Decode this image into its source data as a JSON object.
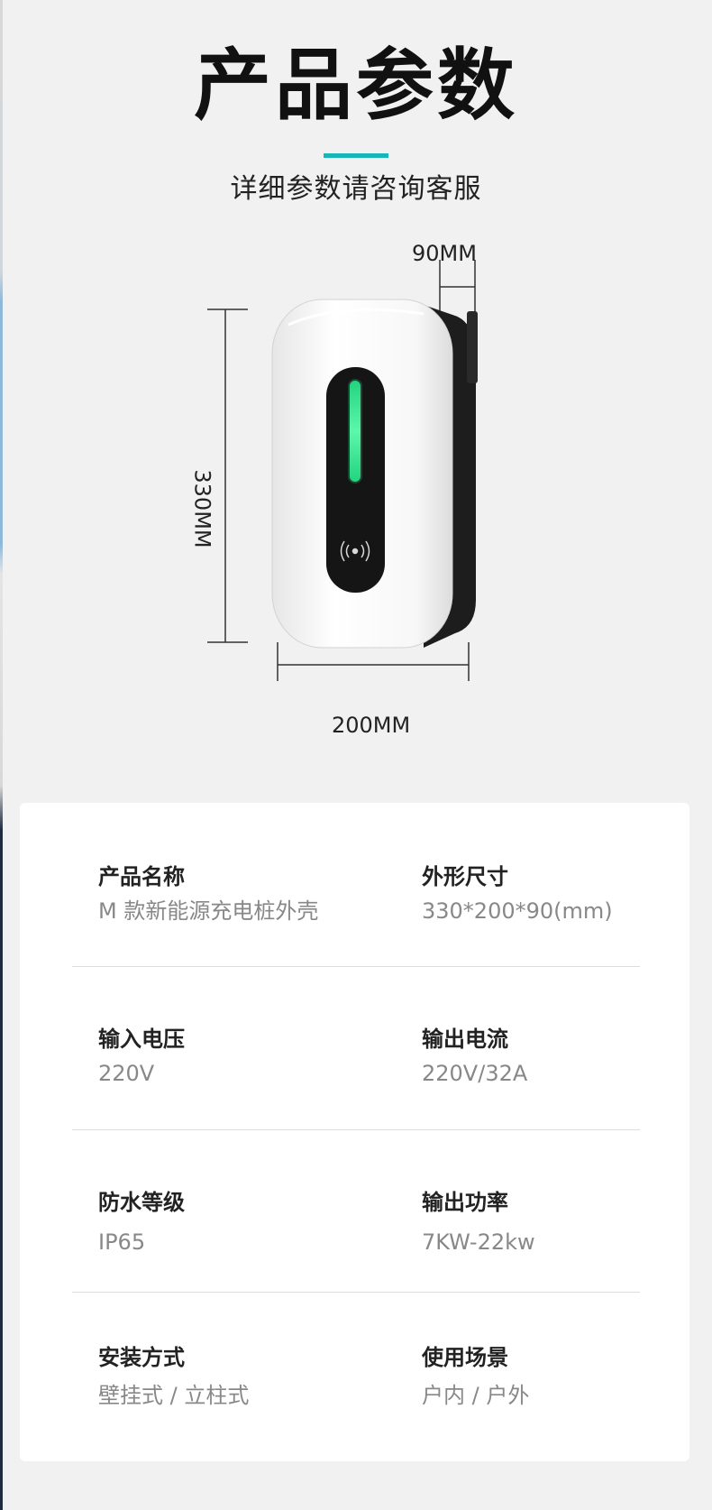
{
  "header": {
    "title": "产品参数",
    "subtitle": "详细参数请咨询客服",
    "accent_color": "#19b6b7"
  },
  "diagram": {
    "depth_label": "90MM",
    "height_label": "330MM",
    "width_label": "200MM",
    "indicator_color": "#2ee08a",
    "icons": [
      "charger-body-icon",
      "nfc-card-reader-icon"
    ]
  },
  "specs": {
    "rows": [
      {
        "left": {
          "label": "产品名称",
          "value": "M 款新能源充电桩外壳"
        },
        "right": {
          "label": "外形尺寸",
          "value": "330*200*90(mm)"
        }
      },
      {
        "left": {
          "label": "输入电压",
          "value": "220V"
        },
        "right": {
          "label": "输出电流",
          "value": "220V/32A"
        }
      },
      {
        "left": {
          "label": "防水等级",
          "value": "IP65"
        },
        "right": {
          "label": "输出功率",
          "value": "7KW-22kw"
        }
      },
      {
        "left": {
          "label": "安装方式",
          "value": "壁挂式 / 立柱式"
        },
        "right": {
          "label": "使用场景",
          "value": "户内 / 户外"
        }
      }
    ]
  }
}
